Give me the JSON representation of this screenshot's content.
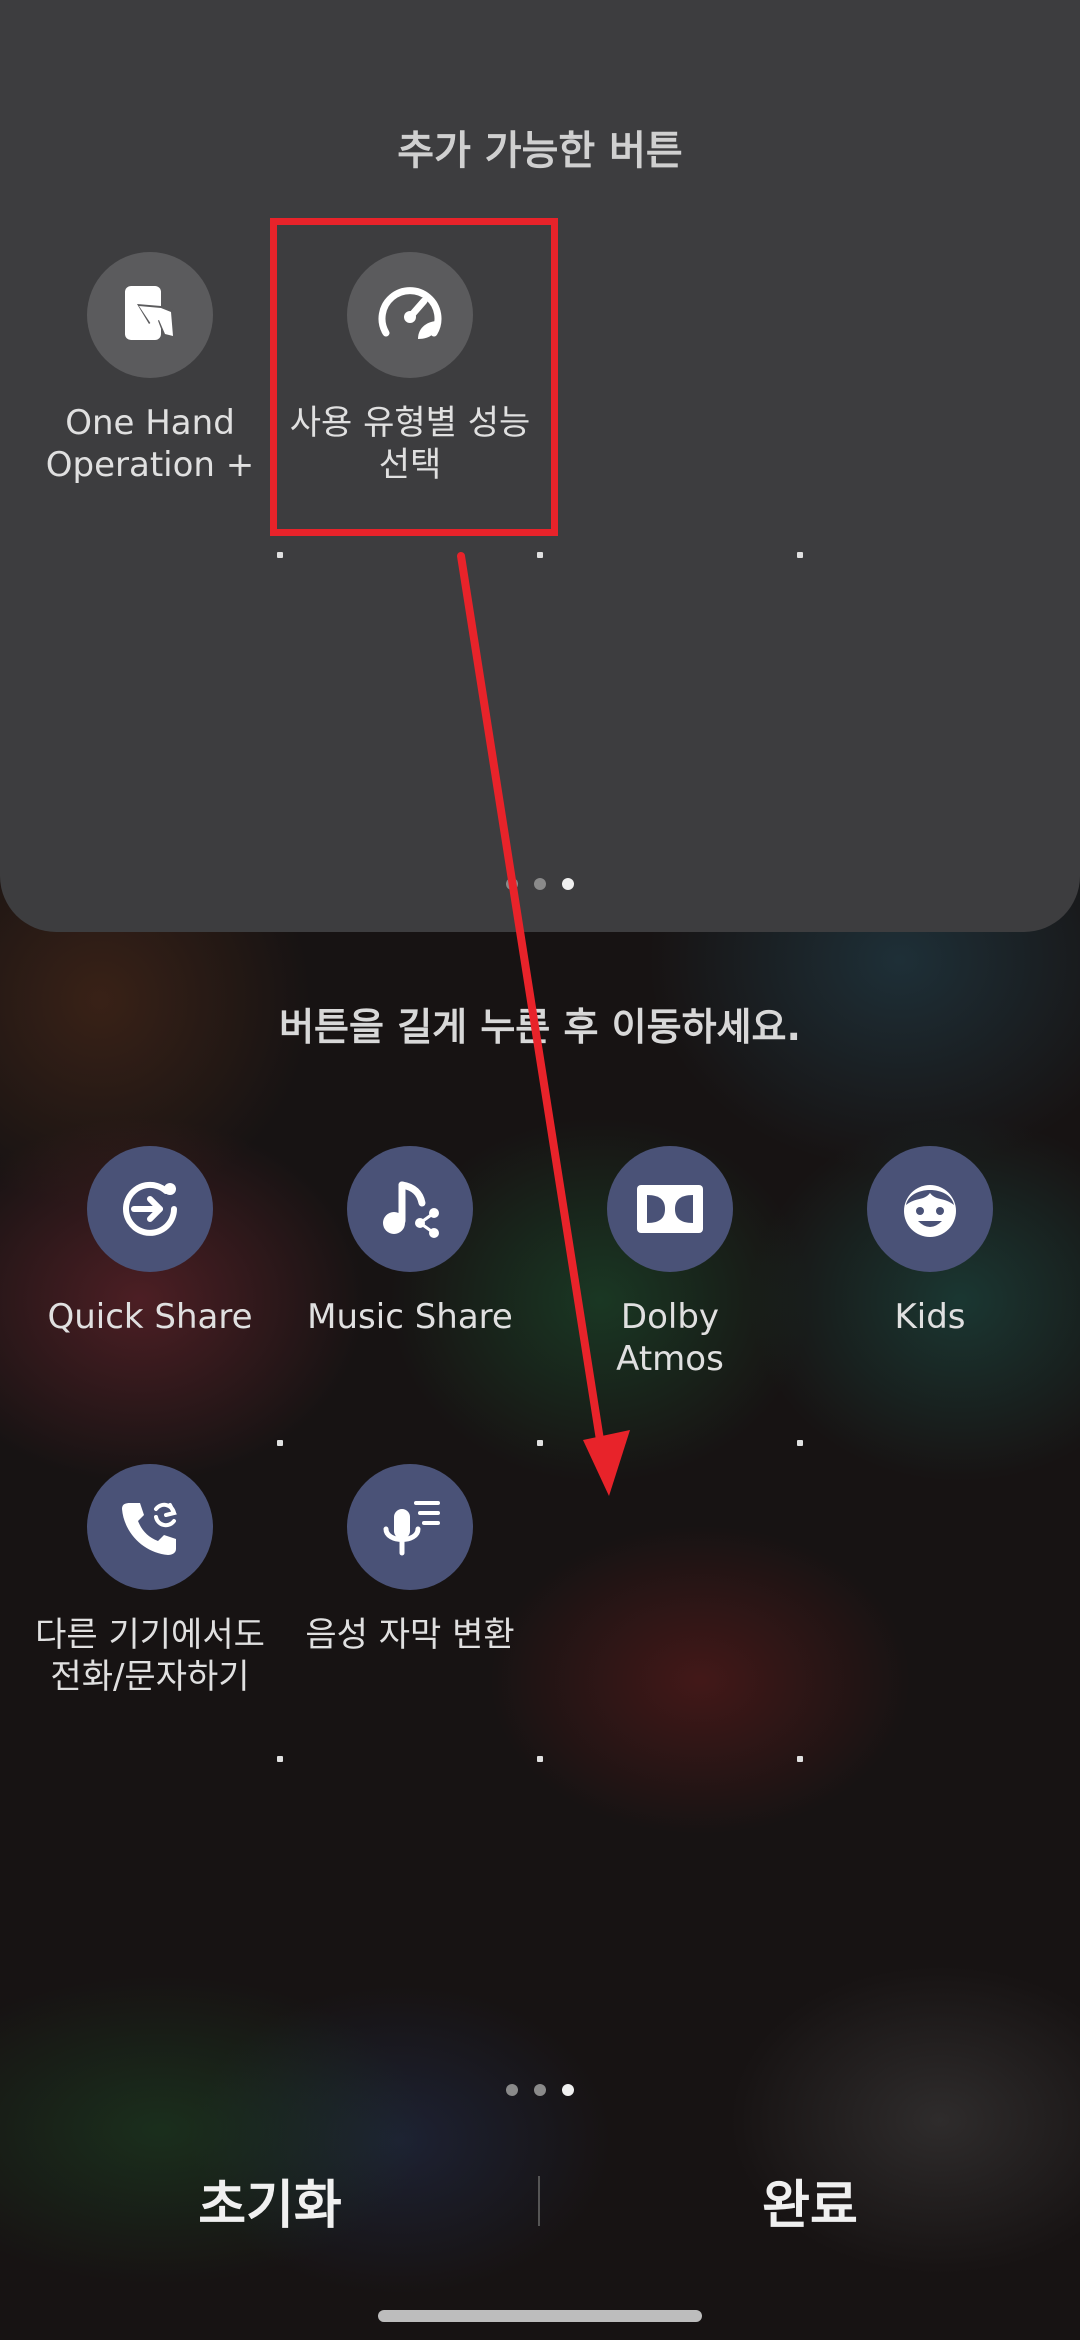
{
  "panel": {
    "title": "추가 가능한 버튼",
    "tiles": [
      {
        "label": "One Hand\nOperation +",
        "icon": "one-hand-icon"
      },
      {
        "label": "사용 유형별 성능\n선택",
        "icon": "performance-gauge-icon"
      }
    ]
  },
  "hint": "버튼을 길게 누른 후 이동하세요.",
  "active_buttons": [
    {
      "label": "Quick Share",
      "icon": "quick-share-icon"
    },
    {
      "label": "Music Share",
      "icon": "music-share-icon"
    },
    {
      "label": "Dolby\nAtmos",
      "icon": "dolby-icon"
    },
    {
      "label": "Kids",
      "icon": "kids-icon"
    },
    {
      "label": "다른 기기에서도\n전화/문자하기",
      "icon": "call-sync-icon"
    },
    {
      "label": "음성 자막 변환",
      "icon": "live-caption-icon"
    }
  ],
  "footer": {
    "reset_label": "초기화",
    "done_label": "완료"
  },
  "colors": {
    "panel_bg": "#3d3d3f",
    "active_circle": "#4a5277",
    "highlight": "#e8232a"
  }
}
